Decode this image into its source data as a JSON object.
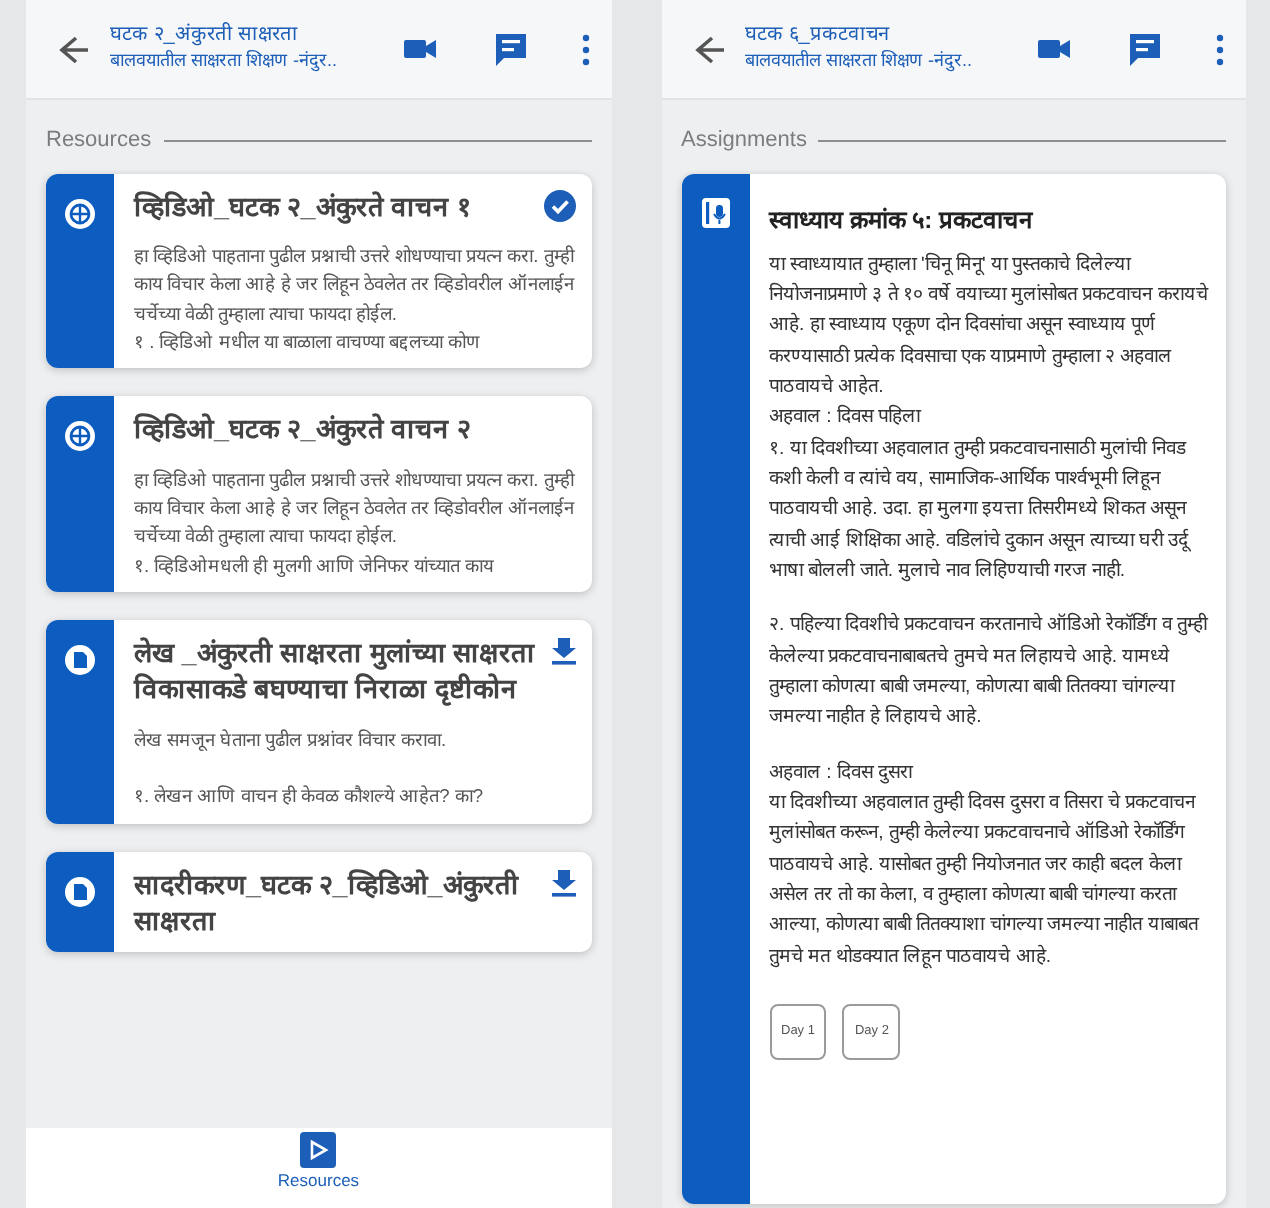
{
  "screens": [
    {
      "header": {
        "title": "घटक २_अंकुरती साक्षरता",
        "subtitle": "बालवयातील साक्षरता शिक्षण -नंदुर.."
      },
      "section_label": "Resources",
      "cards": [
        {
          "kind": "web",
          "title": "व्हिडिओ_घटक २_अंकुरते वाचन १",
          "completed": true,
          "downloadable": false,
          "body": "हा व्हिडिओ  पाहताना पुढील प्रश्नाची उत्तरे शोधण्याचा प्रयत्न करा.  तुम्ही काय विचार केला आहे हे जर लिहून ठेवलेत तर व्हिडोवरील ऑनलाईन चर्चेच्या वेळी तुम्हाला त्याचा फायदा होईल.\n१ . व्हिडिओ मधील या बाळाला वाचण्या बद्दलच्या कोण"
        },
        {
          "kind": "web",
          "title": "व्हिडिओ_घटक २_अंकुरते वाचन २",
          "completed": false,
          "downloadable": false,
          "body": "हा व्हिडिओ  पाहताना पुढील प्रश्नाची उत्तरे शोधण्याचा प्रयत्न करा.  तुम्ही काय विचार केला आहे हे जर लिहून ठेवलेत तर व्हिडोवरील ऑनलाईन चर्चेच्या वेळी तुम्हाला त्याचा फायदा होईल.\n१. व्हिडिओमधली ही मुलगी आणि जेनिफर यांच्यात काय"
        },
        {
          "kind": "pdf",
          "title": "लेख _अंकुरती साक्षरता मुलांच्या साक्षरता  विकासाकडे बघण्याचा निराळा दृष्टीकोन",
          "completed": false,
          "downloadable": true,
          "body": "लेख समजून घेताना पुढील प्रश्नांवर विचार करावा.\n\n१. लेखन आणि वाचन ही केवळ कौशल्ये आहेत? का?"
        },
        {
          "kind": "pdf",
          "title": "सादरीकरण_घटक २_व्हिडिओ_अंकुरती साक्षरता",
          "completed": false,
          "downloadable": true
        }
      ],
      "bottom_nav": [
        {
          "label": "Resources",
          "selected": true
        }
      ]
    },
    {
      "header": {
        "title": "घटक ६_प्रकटवाचन",
        "subtitle": "बालवयातील साक्षरता शिक्षण -नंदुर.."
      },
      "section_label": "Assignments",
      "assignment": {
        "title": "स्वाध्याय क्रमांक ५: प्रकटवाचन",
        "paragraphs": [
          "या स्वाध्यायात तुम्हाला 'चिनू मिनू' या पुस्तकाचे दिलेल्या नियोजनाप्रमाणे ३ ते १० वर्षे वयाच्या मुलांसोबत प्रकटवाचन करायचे आहे. हा स्वाध्याय एकूण दोन दिवसांचा असून स्वाध्याय पूर्ण करण्यासाठी प्रत्येक दिवसाचा एक याप्रमाणे तुम्हाला २ अहवाल पाठवायचे आहेत.\nअहवाल : दिवस पहिला\n१. या दिवशीच्या अहवालात तुम्ही प्रकटवाचनासाठी मुलांची निवड कशी केली व त्यांचे वय, सामाजिक-आर्थिक पार्श्वभूमी लिहून पाठवायची आहे. उदा. हा मुलगा इयत्ता तिसरीमध्ये शिकत असून त्याची आई शिक्षिका आहे. वडिलांचे दुकान असून त्याच्या घरी उर्दू भाषा बोलली जाते. मुलाचे नाव लिहिण्याची गरज नाही.",
          "२. पहिल्या दिवशीचे प्रकटवाचन करतानाचे ऑडिओ रेकॉर्डिंग व तुम्ही केलेल्या प्रकटवाचनाबाबतचे तुमचे मत लिहायचे आहे. यामध्ये तुम्हाला कोणत्या बाबी जमल्या, कोणत्या बाबी तितक्या चांगल्या जमल्या नाहीत हे लिहायचे आहे.",
          "अहवाल : दिवस दुसरा\nया दिवशीच्या अहवालात तुम्ही दिवस दुसरा व तिसरा चे प्रकटवाचन मुलांसोबत करून, तुम्ही केलेल्या प्रकटवाचनाचे ऑडिओ रेकॉर्डिंग पाठवायचे आहे. यासोबत तुम्ही नियोजनात जर काही बदल केला असेल तर तो का केला, व तुम्हाला कोणत्या बाबी चांगल्या करता आल्या, कोणत्या बाबी तितक्याशा चांगल्या जमल्या नाहीत याबाबत तुमचे मत थोडक्यात लिहून पाठवायचे आहे."
        ],
        "attachments": [
          "Day 1",
          "Day 2"
        ]
      }
    }
  ]
}
